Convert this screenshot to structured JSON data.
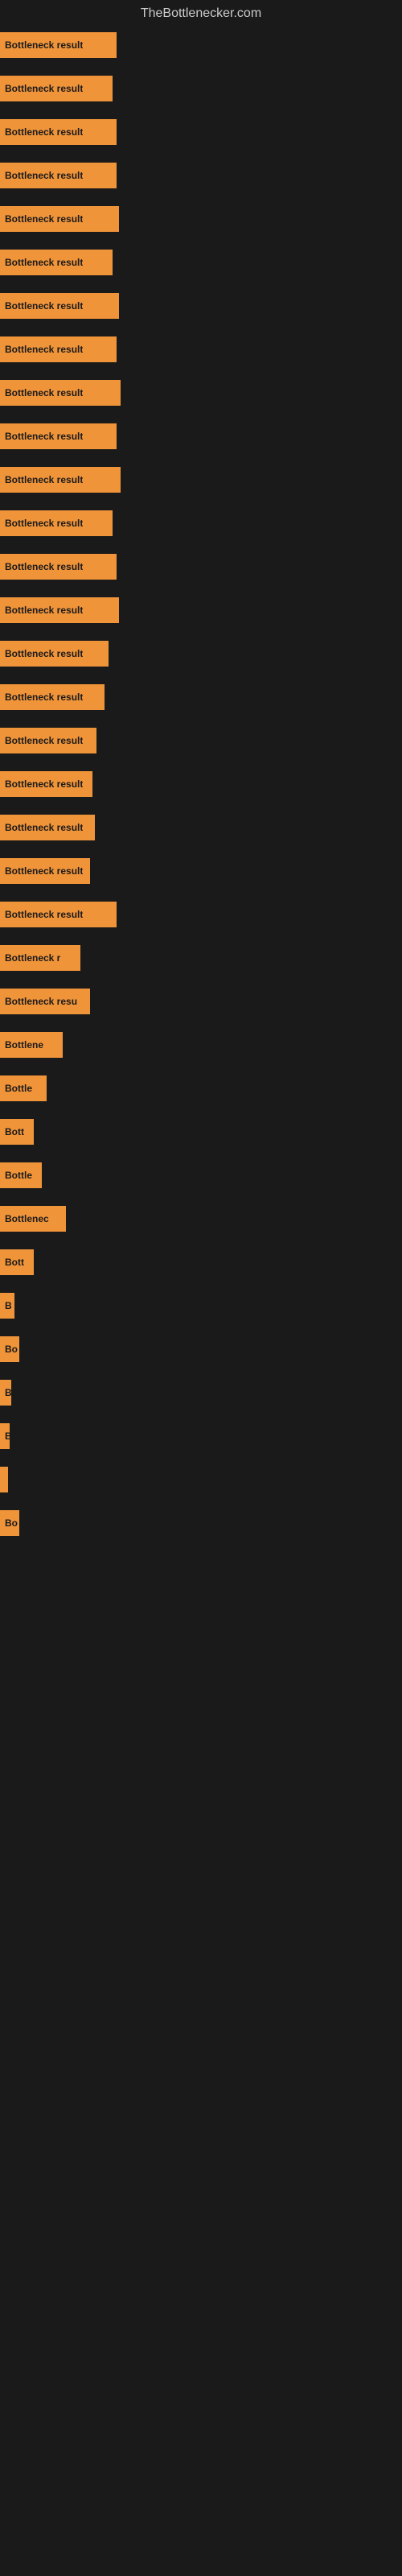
{
  "site": {
    "title": "TheBottlenecker.com"
  },
  "bars": [
    {
      "label": "Bottleneck result",
      "width": 145,
      "visible_label": "Bottleneck result"
    },
    {
      "label": "Bottleneck result",
      "width": 140,
      "visible_label": "Bottleneck result"
    },
    {
      "label": "Bottleneck result",
      "width": 145,
      "visible_label": "Bottleneck result"
    },
    {
      "label": "Bottleneck result",
      "width": 145,
      "visible_label": "Bottleneck result"
    },
    {
      "label": "Bottleneck result",
      "width": 148,
      "visible_label": "Bottleneck result"
    },
    {
      "label": "Bottleneck result",
      "width": 140,
      "visible_label": "Bottleneck result"
    },
    {
      "label": "Bottleneck result",
      "width": 148,
      "visible_label": "Bottleneck result"
    },
    {
      "label": "Bottleneck result",
      "width": 145,
      "visible_label": "Bottleneck result"
    },
    {
      "label": "Bottleneck result",
      "width": 150,
      "visible_label": "Bottleneck result"
    },
    {
      "label": "Bottleneck result",
      "width": 145,
      "visible_label": "Bottleneck result"
    },
    {
      "label": "Bottleneck result",
      "width": 150,
      "visible_label": "Bottleneck result"
    },
    {
      "label": "Bottleneck result",
      "width": 140,
      "visible_label": "Bottleneck result"
    },
    {
      "label": "Bottleneck result",
      "width": 145,
      "visible_label": "Bottleneck result"
    },
    {
      "label": "Bottleneck result",
      "width": 148,
      "visible_label": "Bottleneck result"
    },
    {
      "label": "Bottleneck result",
      "width": 135,
      "visible_label": "Bottleneck result"
    },
    {
      "label": "Bottleneck result",
      "width": 130,
      "visible_label": "Bottleneck result"
    },
    {
      "label": "Bottleneck result",
      "width": 120,
      "visible_label": "Bottleneck result"
    },
    {
      "label": "Bottleneck result",
      "width": 115,
      "visible_label": "Bottleneck result"
    },
    {
      "label": "Bottleneck result",
      "width": 118,
      "visible_label": "Bottleneck result"
    },
    {
      "label": "Bottleneck result",
      "width": 112,
      "visible_label": "Bottleneck result"
    },
    {
      "label": "Bottleneck result",
      "width": 145,
      "visible_label": "Bottleneck result"
    },
    {
      "label": "Bottleneck r",
      "width": 100,
      "visible_label": "Bottleneck r"
    },
    {
      "label": "Bottleneck resu",
      "width": 112,
      "visible_label": "Bottleneck resu"
    },
    {
      "label": "Bottlene",
      "width": 78,
      "visible_label": "Bottlene"
    },
    {
      "label": "Bottle",
      "width": 58,
      "visible_label": "Bottle"
    },
    {
      "label": "Bott",
      "width": 42,
      "visible_label": "Bott"
    },
    {
      "label": "Bottle",
      "width": 52,
      "visible_label": "Bottle"
    },
    {
      "label": "Bottlenec",
      "width": 82,
      "visible_label": "Bottlenec"
    },
    {
      "label": "Bott",
      "width": 42,
      "visible_label": "Bott"
    },
    {
      "label": "B",
      "width": 18,
      "visible_label": "B"
    },
    {
      "label": "Bo",
      "width": 24,
      "visible_label": "Bo"
    },
    {
      "label": "B",
      "width": 14,
      "visible_label": "B"
    },
    {
      "label": "B",
      "width": 12,
      "visible_label": "B"
    },
    {
      "label": "",
      "width": 8,
      "visible_label": ""
    },
    {
      "label": "Bo",
      "width": 24,
      "visible_label": "Bo"
    }
  ]
}
